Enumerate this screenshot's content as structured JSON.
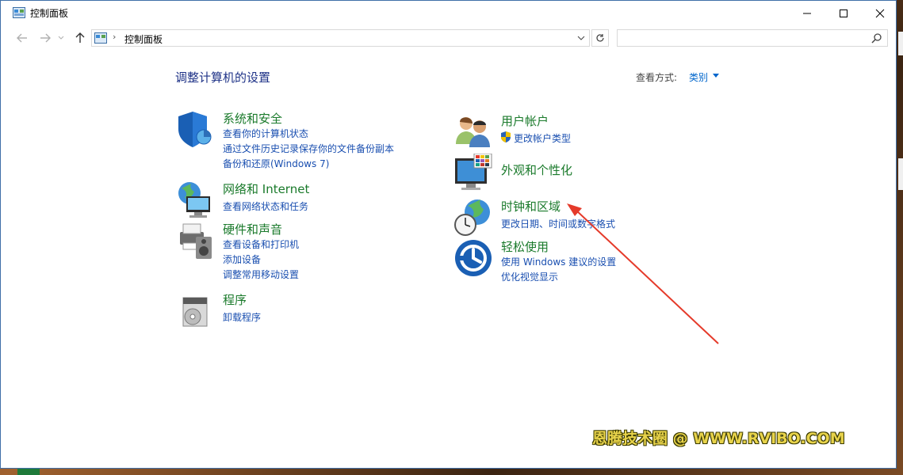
{
  "window": {
    "title": "控制面板"
  },
  "caption": {
    "minimize": "—",
    "maximize": "☐",
    "close": "✕"
  },
  "nav": {
    "back": "←",
    "forward": "→",
    "recent": "⌄",
    "up": "↑",
    "address": {
      "separator": "›",
      "path": "控制面板"
    },
    "search": {
      "placeholder": ""
    }
  },
  "content": {
    "heading": "调整计算机的设置",
    "view_by": {
      "label": "查看方式:",
      "value": "类别"
    }
  },
  "categories_left": [
    {
      "icon": "shield-icon",
      "title": "系统和安全",
      "links": [
        "查看你的计算机状态",
        "通过文件历史记录保存你的文件备份副本",
        "备份和还原(Windows 7)"
      ]
    },
    {
      "icon": "network-globe-icon",
      "title": "网络和 Internet",
      "links": [
        "查看网络状态和任务"
      ]
    },
    {
      "icon": "printer-speaker-icon",
      "title": "硬件和声音",
      "links": [
        "查看设备和打印机",
        "添加设备",
        "调整常用移动设置"
      ]
    },
    {
      "icon": "programs-disk-icon",
      "title": "程序",
      "links": [
        "卸载程序"
      ]
    }
  ],
  "categories_right": [
    {
      "icon": "users-icon",
      "title": "用户帐户",
      "links": [
        "更改帐户类型"
      ]
    },
    {
      "icon": "monitor-palette-icon",
      "title": "外观和个性化",
      "links": []
    },
    {
      "icon": "globe-clock-icon",
      "title": "时钟和区域",
      "links": [
        "更改日期、时间或数字格式"
      ]
    },
    {
      "icon": "ease-of-access-icon",
      "title": "轻松使用",
      "links": [
        "使用 Windows 建议的设置",
        "优化视觉显示"
      ]
    }
  ],
  "watermark": "恩腾技术圈 @ WWW.RVIBO.COM",
  "colors": {
    "category_title": "#1a7a2b",
    "link": "#1a4fb0",
    "heading": "#1e3287",
    "annotation_arrow": "#e53a2a"
  }
}
